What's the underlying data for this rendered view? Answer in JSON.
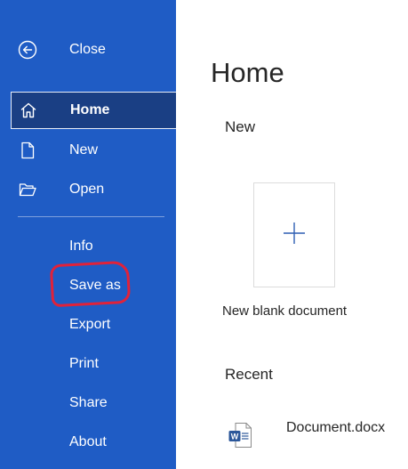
{
  "sidebar": {
    "close_label": "Close",
    "items": {
      "home": "Home",
      "new": "New",
      "open": "Open",
      "info": "Info",
      "save_as": "Save as",
      "export": "Export",
      "print": "Print",
      "share": "Share",
      "about": "About"
    },
    "icons": {
      "close": "back-arrow-circle-icon",
      "home": "home-icon",
      "new": "new-document-icon",
      "open": "open-folder-icon"
    },
    "colors": {
      "background": "#1f5cc5",
      "selected": "#1a3f84",
      "annotation": "#e0223a"
    }
  },
  "main": {
    "title": "Home",
    "new_section": {
      "heading": "New",
      "blank_document_label": "New blank document",
      "plus_icon": "plus-icon"
    },
    "recent_section": {
      "heading": "Recent",
      "items": [
        {
          "name": "Document.docx",
          "icon": "word-document-icon"
        }
      ]
    }
  }
}
